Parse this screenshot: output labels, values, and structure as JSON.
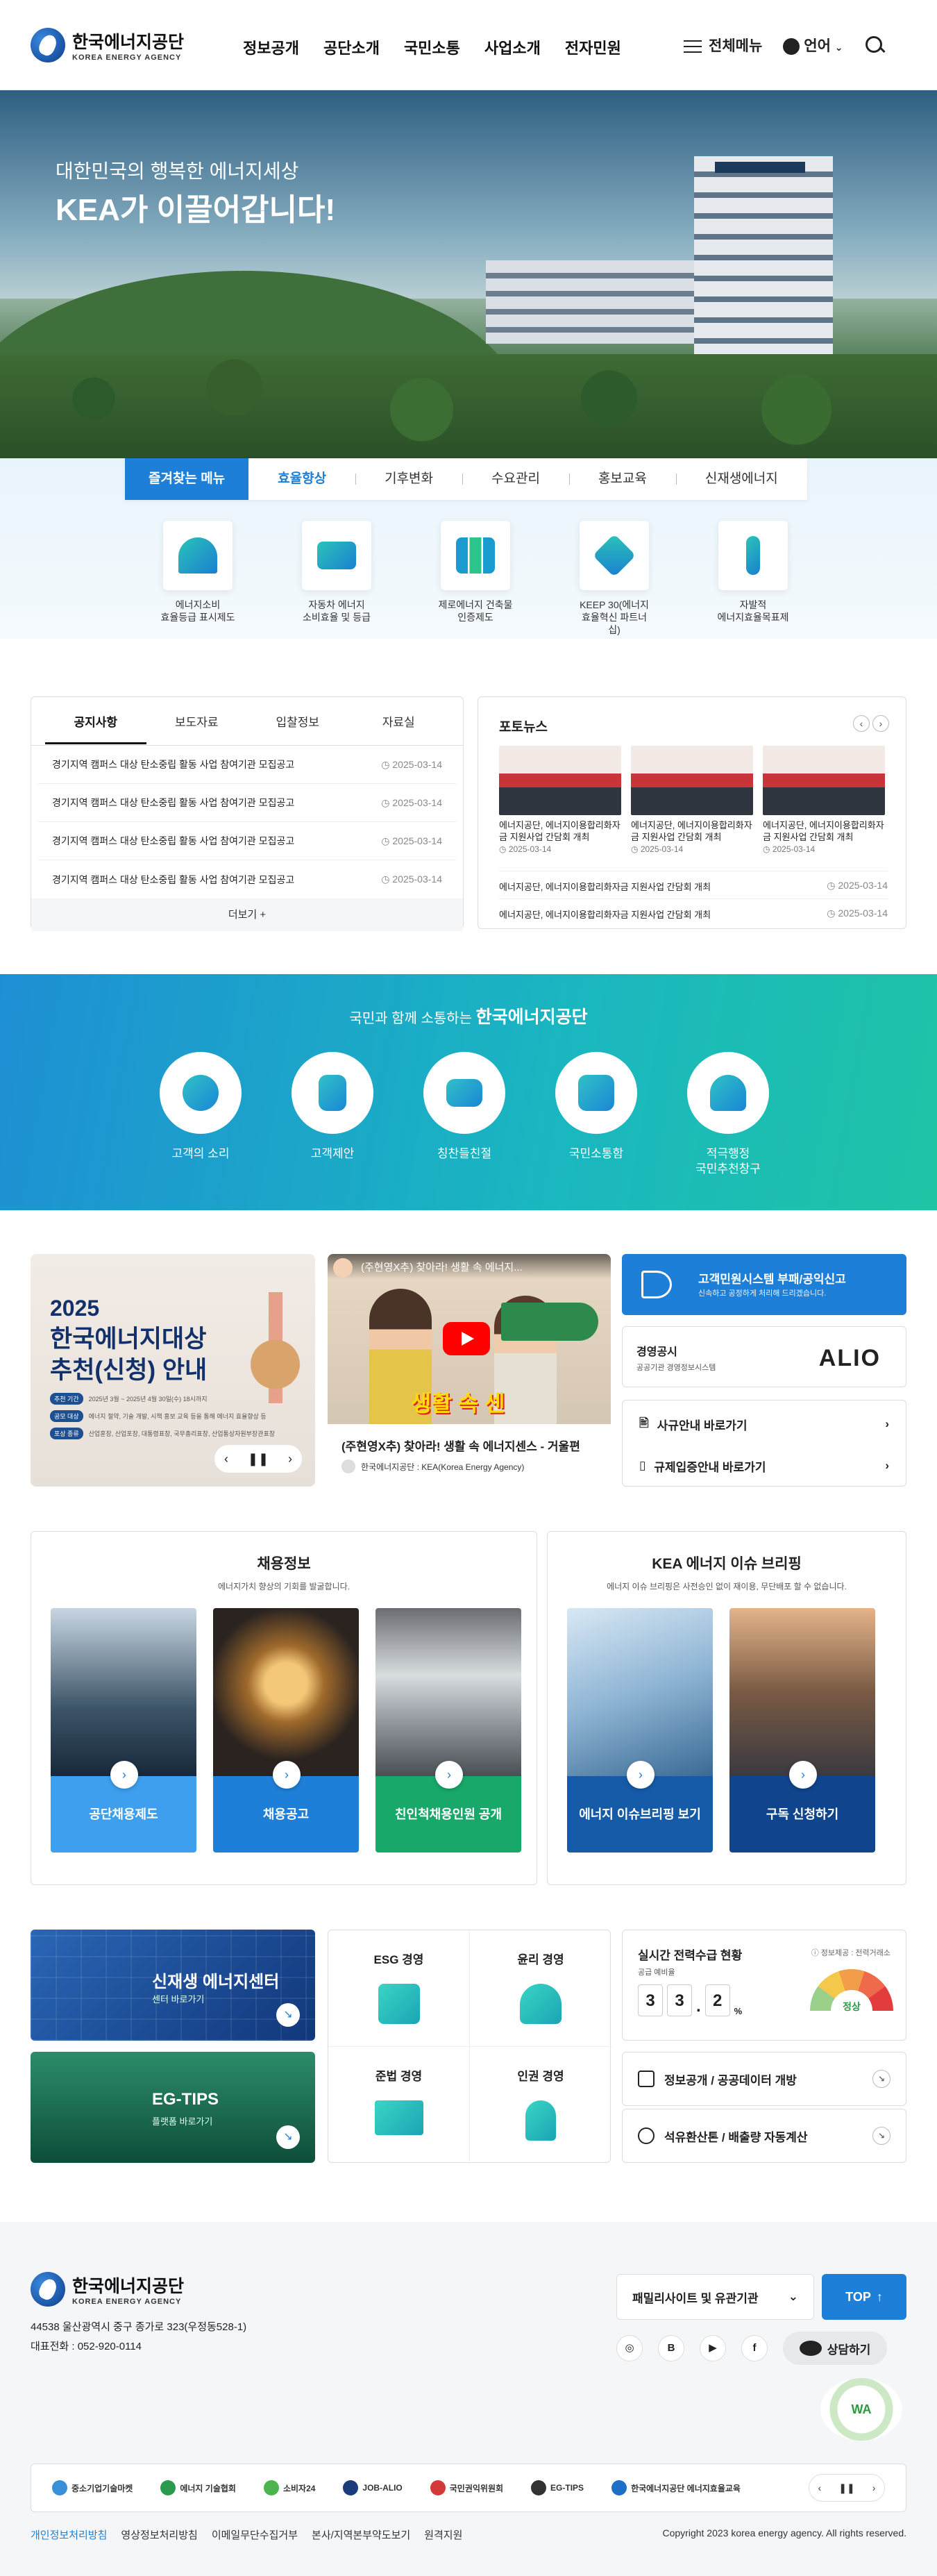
{
  "header": {
    "logo_title": "한국에너지공단",
    "logo_sub": "KOREA ENERGY AGENCY",
    "nav": [
      "정보공개",
      "공단소개",
      "국민소통",
      "사업소개",
      "전자민원"
    ],
    "all_menu": "전체메뉴",
    "language": "언어"
  },
  "hero": {
    "line1": "대한민국의 행복한 에너지세상",
    "line2": "KEA가 이끌어갑니다!"
  },
  "quick": {
    "lead_tab": "즐겨찾는 메뉴",
    "tabs": [
      "효율향상",
      "기후변화",
      "수요관리",
      "홍보교육",
      "신재생에너지"
    ],
    "items": [
      {
        "l1": "에너지소비",
        "l2": "효율등급 표시제도"
      },
      {
        "l1": "자동차 에너지",
        "l2": "소비효율 및 등급"
      },
      {
        "l1": "제로에너지 건축물",
        "l2": "인증제도"
      },
      {
        "l1": "KEEP 30(에너지",
        "l2": "효율혁신 파트너십)"
      },
      {
        "l1": "자발적",
        "l2": "에너지효율목표제"
      }
    ]
  },
  "board": {
    "tabs": [
      "공지사항",
      "보도자료",
      "입찰정보",
      "자료실"
    ],
    "rows": [
      {
        "title": "경기지역 캠퍼스 대상 탄소중립 활동 사업 참여기관 모집공고",
        "date": "2025-03-14"
      },
      {
        "title": "경기지역 캠퍼스 대상 탄소중립 활동 사업 참여기관 모집공고",
        "date": "2025-03-14"
      },
      {
        "title": "경기지역 캠퍼스 대상 탄소중립 활동 사업 참여기관 모집공고",
        "date": "2025-03-14"
      },
      {
        "title": "경기지역 캠퍼스 대상 탄소중립 활동 사업 참여기관 모집공고",
        "date": "2025-03-14"
      }
    ],
    "more": "더보기 +"
  },
  "photo": {
    "title": "포토뉴스",
    "cards": [
      {
        "title": "에너지공단, 에너지이용합리화자금 지원사업 간담회 개최",
        "date": "2025-03-14"
      },
      {
        "title": "에너지공단, 에너지이용합리화자금 지원사업 간담회 개최",
        "date": "2025-03-14"
      },
      {
        "title": "에너지공단, 에너지이용합리화자금 지원사업 간담회 개최",
        "date": "2025-03-14"
      }
    ],
    "rows": [
      {
        "title": "에너지공단, 에너지이용합리화자금 지원사업 간담회 개최",
        "date": "2025-03-14"
      },
      {
        "title": "에너지공단, 에너지이용합리화자금 지원사업 간담회 개최",
        "date": "2025-03-14"
      }
    ]
  },
  "comm": {
    "prefix": "국민과 함께 소통하는",
    "name": "한국에너지공단",
    "items": [
      {
        "l1": "고객의 소리",
        "l2": ""
      },
      {
        "l1": "고객제안",
        "l2": ""
      },
      {
        "l1": "칭찬들친절",
        "l2": ""
      },
      {
        "l1": "국민소통함",
        "l2": ""
      },
      {
        "l1": "적극행정",
        "l2": "국민추천창구"
      }
    ]
  },
  "award": {
    "year": "2025",
    "title1": "한국에너지대상",
    "title2": "추천(신청) 안내",
    "tags": [
      {
        "k": "추천 기간",
        "v": "2025년 3월 ~ 2025년 4월 30일(수) 18시까지"
      },
      {
        "k": "공모 대상",
        "v": "에너지 절약, 기술 개발, 시책 홍보 교육 등을 통해 에너지 효율향상 등"
      },
      {
        "k": "포상 종류",
        "v": "산업훈장, 산업포장, 대통령표창, 국무총리표창, 산업통상자원부장관표창"
      }
    ]
  },
  "video": {
    "top": "(주현영X추) 찾아라! 생활 속 에너지...",
    "caption": "생활 속 센",
    "title": "(주현영X추) 찾아라! 생활 속 에너지센스 - 거울편",
    "channel": "한국에너지공단 : KEA(Korea Energy Agency)"
  },
  "side": {
    "report_title": "고객민원시스템 부패/공익신고",
    "report_sub": "신속하고 공정하게 처리해 드리겠습니다.",
    "disclosure_title": "경영공시",
    "disclosure_sub": "공공기관 경영정보시스템",
    "alio": "ALIO",
    "links": [
      "사규안내 바로가기",
      "규제입증안내 바로가기"
    ]
  },
  "recruit": {
    "title": "채용정보",
    "sub": "에너지가치 향상의 기회를 발굴합니다.",
    "cards": [
      {
        "l1": "공단채용제도",
        "l2": ""
      },
      {
        "l1": "채용공고",
        "l2": ""
      },
      {
        "l1": "친인척",
        "l2": "채용인원 공개"
      }
    ]
  },
  "issue": {
    "title": "KEA 에너지 이슈 브리핑",
    "sub": "에너지 이슈 브리핑은 사전승인 없이 재이용, 무단배포 할 수 없습니다.",
    "cards": [
      {
        "l1": "에너지 이슈",
        "l2": "브리핑 보기"
      },
      {
        "l1": "구독 신청하기",
        "l2": ""
      }
    ]
  },
  "banners": {
    "nre_title": "신재생 에너지센터",
    "nre_sub": "센터 바로가기",
    "eg_title": "EG-TIPS",
    "eg_sub": "플랫폼 바로가기"
  },
  "esg": [
    "ESG 경영",
    "윤리 경영",
    "준법 경영",
    "인권 경영"
  ],
  "power": {
    "title": "실시간 전력수급 현황",
    "source": "정보제공 : 전력거래소",
    "label": "공급 예비율",
    "digits": [
      "3",
      "3",
      ".",
      "2"
    ],
    "unit": "%",
    "status": "정상"
  },
  "links": [
    "정보공개 / 공공데이터 개방",
    "석유환산톤 / 배출량 자동계산"
  ],
  "footer": {
    "logo_title": "한국에너지공단",
    "logo_sub": "KOREA ENERGY AGENCY",
    "address": "44538 울산광역시 중구 종가로 323(우정동528-1)",
    "tel": "대표전화 : 052-920-0114",
    "family": "패밀리사이트 및 유관기관",
    "top": "TOP",
    "sns": [
      "◎",
      "B",
      "▶",
      "f"
    ],
    "talk": "상담하기",
    "wa": "WA",
    "banner": [
      "중소기업기술마켓",
      "에너지 기술협회",
      "소비자24",
      "JOB-ALIO",
      "국민권익위원회",
      "EG-TIPS",
      "한국에너지공단 에너지효율교육"
    ],
    "links": [
      "개인정보처리방침",
      "영상정보처리방침",
      "이메일무단수집거부",
      "본사/지역본부약도보기",
      "원격지원"
    ],
    "copyright": "Copyright 2023 korea energy agency. All rights reserved."
  }
}
